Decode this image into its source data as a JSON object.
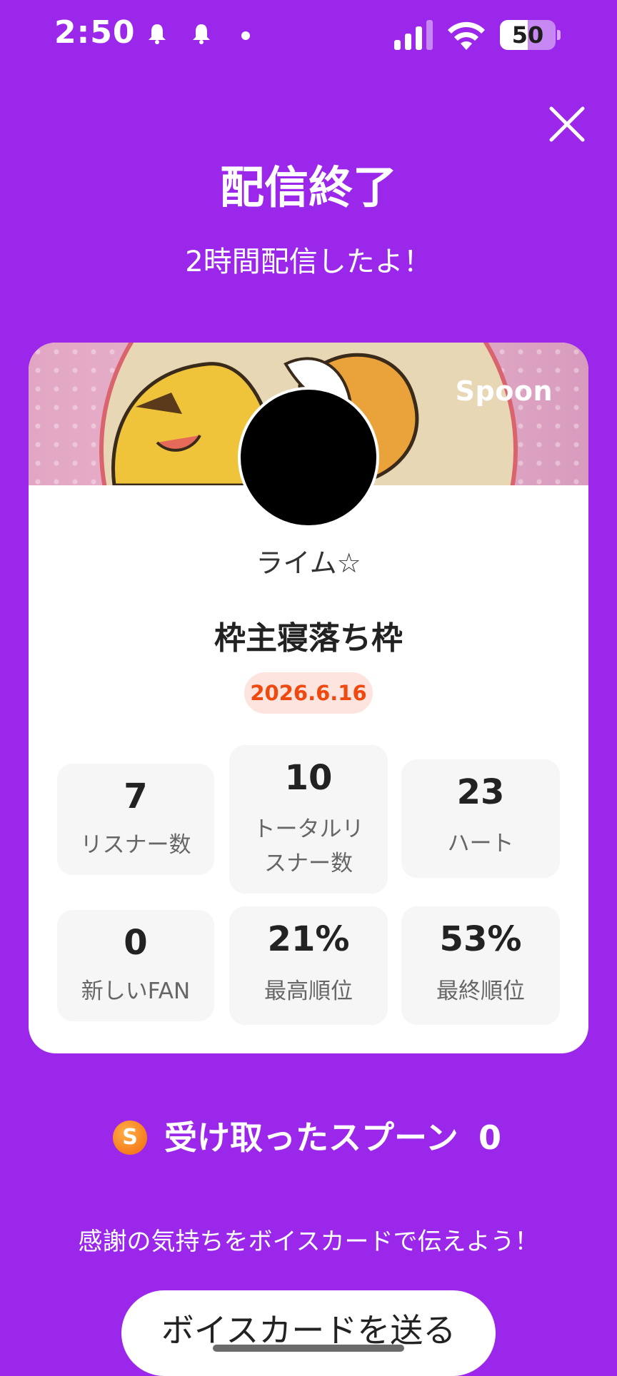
{
  "status_bar": {
    "time": "2:50",
    "battery": "50",
    "battery_level": 0.5,
    "icons": [
      "notification-bell-icon",
      "notification-bell-icon",
      "dot-icon",
      "cellular-signal-icon",
      "wifi-icon",
      "battery-icon"
    ]
  },
  "header": {
    "close_icon": "close-icon",
    "title": "配信終了",
    "subtitle": "2時間配信したよ！"
  },
  "card": {
    "brand": "Spoon",
    "host_name": "ライム☆",
    "live_title": "枠主寝落ち枠",
    "date": "2026.6.16",
    "stats": [
      {
        "value": "7",
        "label": "リスナー数"
      },
      {
        "value": "10",
        "label": "トータルリスナー数"
      },
      {
        "value": "23",
        "label": "ハート"
      },
      {
        "value": "0",
        "label": "新しいFAN"
      },
      {
        "value": "21%",
        "label": "最高順位"
      },
      {
        "value": "53%",
        "label": "最終順位"
      }
    ]
  },
  "spoons": {
    "coin_letter": "S",
    "label": "受け取ったスプーン",
    "count": "0"
  },
  "footer": {
    "thanks": "感謝の気持ちをボイスカードで伝えよう！",
    "voice_card_button": "ボイスカードを送る"
  },
  "colors": {
    "background": "#9b27ea",
    "card": "#ffffff",
    "date_badge_text": "#f0490f",
    "date_badge_bg": "#fde4df"
  }
}
